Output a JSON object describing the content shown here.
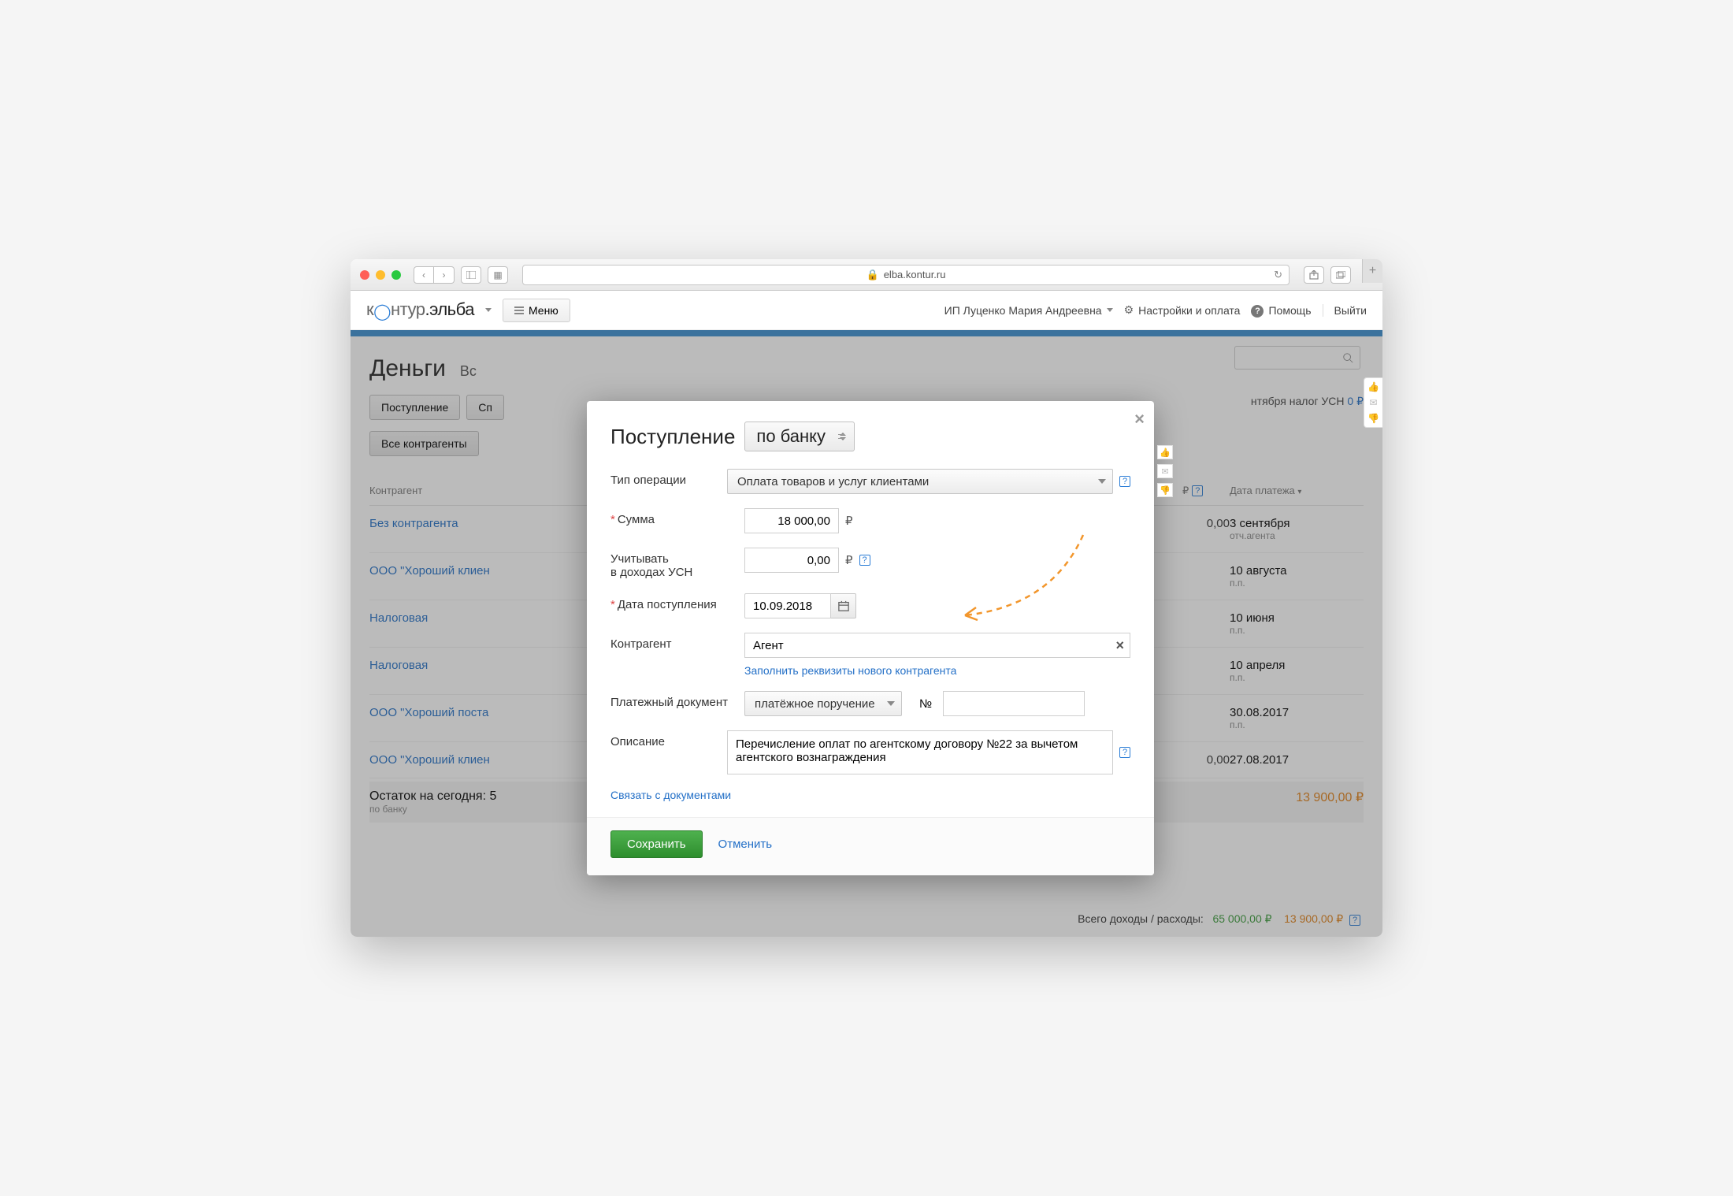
{
  "browser": {
    "url": "elba.kontur.ru"
  },
  "topbar": {
    "logo_part1": "к",
    "logo_part2": "нтур",
    "logo_part3": ".эльба",
    "menu": "Меню",
    "user": "ИП Луценко Мария Андреевна",
    "settings": "Настройки и оплата",
    "help": "Помощь",
    "logout": "Выйти"
  },
  "bg": {
    "title": "Деньги",
    "tab_all": "Вс",
    "btn_in": "Поступление",
    "btn_out": "Сп",
    "btn_all_contractors": "Все контрагенты",
    "th_contractor": "Контрагент",
    "th_pay_col": "₽",
    "th_date": "Дата платежа",
    "tax_label_pre": "нтября налог УСН ",
    "tax_value": "0 ₽",
    "balance_label": "Остаток на сегодня:",
    "balance_sub": "по банку",
    "totals_label": "Всего доходы / расходы:",
    "totals_in": "65 000,00 ₽",
    "totals_out_row": "13 900,00 ₽",
    "totals_out": "13 900,00 ₽",
    "rows": [
      {
        "name": "Без контрагента",
        "amt": "0,00",
        "date": "3 сентября",
        "sub": "отч.агента"
      },
      {
        "name": "ООО \"Хороший клиен",
        "amt": "",
        "date": "10 августа",
        "sub": "п.п."
      },
      {
        "name": "Налоговая",
        "amt": "",
        "date": "10 июня",
        "sub": "п.п."
      },
      {
        "name": "Налоговая",
        "amt": "",
        "date": "10 апреля",
        "sub": "п.п."
      },
      {
        "name": "ООО \"Хороший поста",
        "amt": "",
        "date": "30.08.2017",
        "sub": "п.п."
      },
      {
        "name": "ООО \"Хороший клиен",
        "amt": "0,00",
        "date": "27.08.2017",
        "sub": ""
      }
    ]
  },
  "modal": {
    "title": "Поступление",
    "title_select": "по банку",
    "op_label": "Тип операции",
    "op_value": "Оплата товаров и услуг клиентами",
    "sum_label": "Сумма",
    "sum_value": "18 000,00",
    "usn_label": "Учитывать\nв доходах УСН",
    "usn_value": "0,00",
    "date_label": "Дата поступления",
    "date_value": "10.09.2018",
    "agent_label": "Контрагент",
    "agent_value": "Агент",
    "agent_link": "Заполнить реквизиты нового контрагента",
    "doc_label": "Платежный документ",
    "doc_value": "платёжное поручение",
    "doc_no": "№",
    "desc_label": "Описание",
    "desc_value": "Перечисление оплат по агентскому договору №22 за вычетом агентского вознаграждения",
    "link_docs": "Связать с документами",
    "save": "Сохранить",
    "cancel": "Отменить",
    "rub": "₽"
  }
}
